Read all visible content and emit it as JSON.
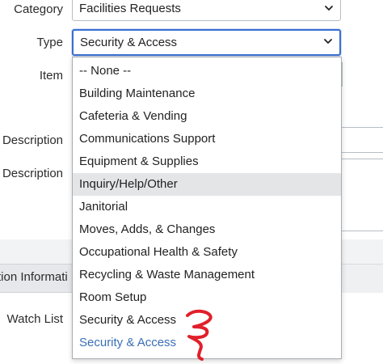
{
  "form": {
    "category_label": "Category",
    "category_value": "Facilities Requests",
    "type_label": "Type",
    "type_value": "Security & Access",
    "item_label": "Item",
    "short_description_label": "Description",
    "description_label": "Description",
    "section_title": "tion Informati",
    "watch_list_label": "Watch List"
  },
  "dropdown": {
    "options": [
      "-- None --",
      "Building Maintenance",
      "Cafeteria & Vending",
      "Communications Support",
      "Equipment & Supplies",
      "Inquiry/Help/Other",
      "Janitorial",
      "Moves, Adds, & Changes",
      "Occupational Health & Safety",
      "Recycling & Waste Management",
      "Room Setup",
      "Security & Access",
      "Security & Access"
    ],
    "hover_index": 5,
    "selected_index": 12
  },
  "colors": {
    "focus_border": "#3a6fd0",
    "hover_bg": "#e4e5e7",
    "selected_text": "#3b6fb6",
    "annotation": "#e0202a"
  },
  "icons": {
    "category_chevron": "chevron-down-icon",
    "type_chevron": "chevron-down-icon"
  }
}
